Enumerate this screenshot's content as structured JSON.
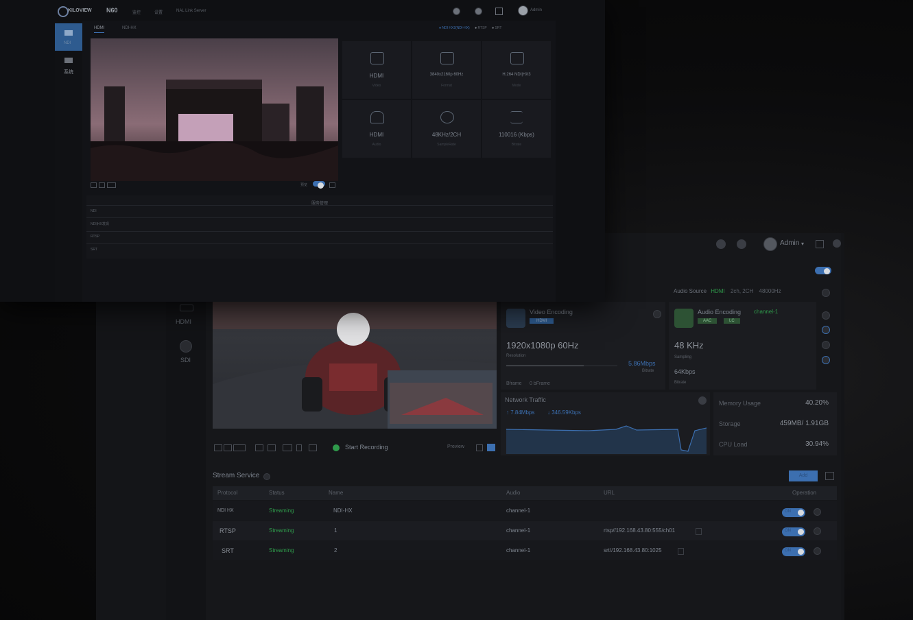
{
  "front_window": {
    "brand": "KILOVIEW",
    "model": "N60",
    "nav": [
      "监控",
      "设置",
      "NAL Link Server"
    ],
    "user": "Admin",
    "tabs": [
      "HDMI",
      "NDI-HX"
    ],
    "status_bar": [
      "NDI HX2(NDI-HX)",
      "RTSP",
      "SRT"
    ],
    "sidebar": [
      "NDI",
      "系统"
    ],
    "tiles": [
      {
        "icon": "video-icon",
        "label": "HDMI",
        "sub": "Video"
      },
      {
        "icon": "monitor-icon",
        "label": "3840x2160p 60Hz",
        "sub": "Format"
      },
      {
        "icon": "layers-icon",
        "label": "H.264 NDI|HX3",
        "sub": "Mode"
      },
      {
        "icon": "headphones-icon",
        "label": "HDMI",
        "sub": "Audio"
      },
      {
        "icon": "broadcast-icon",
        "label": "48KHz/2CH",
        "sub": "SampleRate"
      },
      {
        "icon": "waveform-icon",
        "label": "110016 (Kbps)",
        "sub": "Bitrate"
      }
    ],
    "section_title": "服务管理",
    "rows": [
      "NDI",
      "NDI|HX发现",
      "RTSP",
      "SRT"
    ],
    "toolbar_label": "预览"
  },
  "back_window": {
    "user": "Admin",
    "sidebar": [
      "HDMI",
      "SDI"
    ],
    "audio_source": {
      "label": "Audio Source",
      "value": "HDMI",
      "channels": "2ch, 2CH",
      "rate": "48000Hz"
    },
    "video_encoding": {
      "title": "Video Encoding",
      "badge": "HDMI",
      "resolution": "1920x1080p 60Hz",
      "resolution_label": "Resolution",
      "bitrate": "5.86Mbps",
      "bitrate_label": "Bitrate",
      "bitrate_pct": 0.7,
      "frame_label": "Bframe",
      "frame_value": "0 bFrame"
    },
    "audio_encoding": {
      "title": "Audio Encoding",
      "channel": "channel-1",
      "tags": [
        "AAC",
        "LC"
      ],
      "rate": "48 KHz",
      "rate_label": "Sampling",
      "bitrate": "64Kbps",
      "bitrate_label": "Bitrate"
    },
    "network": {
      "title": "Network Traffic",
      "up": "↑ 7.84Mbps",
      "down": "↓ 346.59Kbps"
    },
    "stats": [
      {
        "label": "Memory Usage",
        "value": "40.20%"
      },
      {
        "label": "Storage",
        "value": "459MB/ 1.91GB"
      },
      {
        "label": "CPU Load",
        "value": "30.94%"
      }
    ],
    "record_label": "Start Recording",
    "preview_label": "Preview",
    "stream_title": "Stream Service",
    "add_label": "Add",
    "table": {
      "headers": [
        "Protocol",
        "Status",
        "Name",
        "Audio",
        "URL",
        "Operation"
      ],
      "rows": [
        [
          "NDI HX",
          "Streaming",
          "NDI-HX",
          "channel-1",
          ""
        ],
        [
          "RTSP",
          "Streaming",
          "1",
          "channel-1",
          "rtsp//192.168.43.80:555/ch01"
        ],
        [
          "SRT",
          "Streaming",
          "2",
          "channel-1",
          "srt//192.168.43.80:1025"
        ]
      ],
      "toggle_label": "ON"
    }
  },
  "colors": {
    "accent": "#3c6fb0",
    "green": "#2f9a4b",
    "bg": "#0b0b0c"
  }
}
